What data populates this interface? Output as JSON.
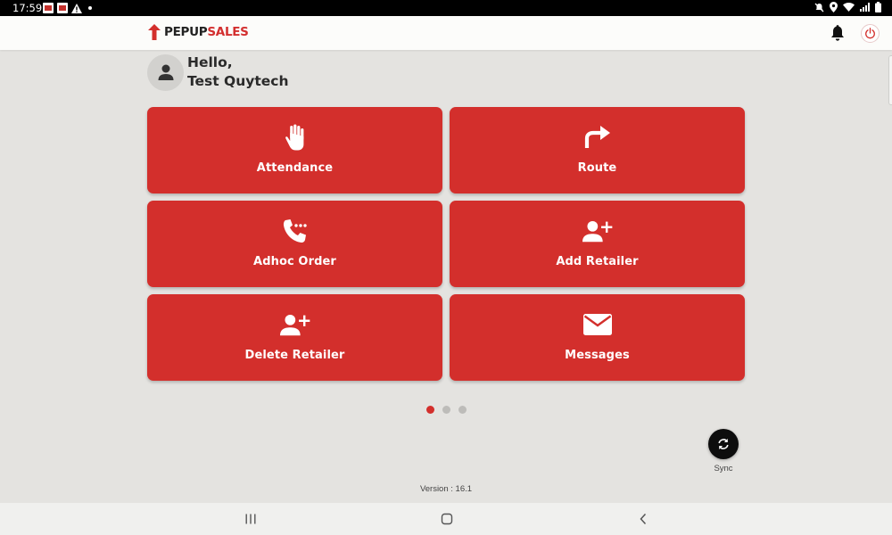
{
  "status_bar": {
    "time": "17:59"
  },
  "app": {
    "logo_part1": "PEPUP",
    "logo_part2": "SALES",
    "accent_color": "#d32f2c"
  },
  "greeting": {
    "hello": "Hello,",
    "user_name": "Test Quytech"
  },
  "tiles": [
    {
      "label": "Attendance",
      "icon": "hand-icon"
    },
    {
      "label": "Route",
      "icon": "turn-right-arrow-icon"
    },
    {
      "label": "Adhoc Order",
      "icon": "phone-dots-icon"
    },
    {
      "label": "Add Retailer",
      "icon": "person-add-icon"
    },
    {
      "label": "Delete Retailer",
      "icon": "person-add-icon"
    },
    {
      "label": "Messages",
      "icon": "envelope-icon"
    }
  ],
  "pager": {
    "pages": 3,
    "current": 1
  },
  "sync": {
    "label": "Sync"
  },
  "version": "Version : 16.1"
}
